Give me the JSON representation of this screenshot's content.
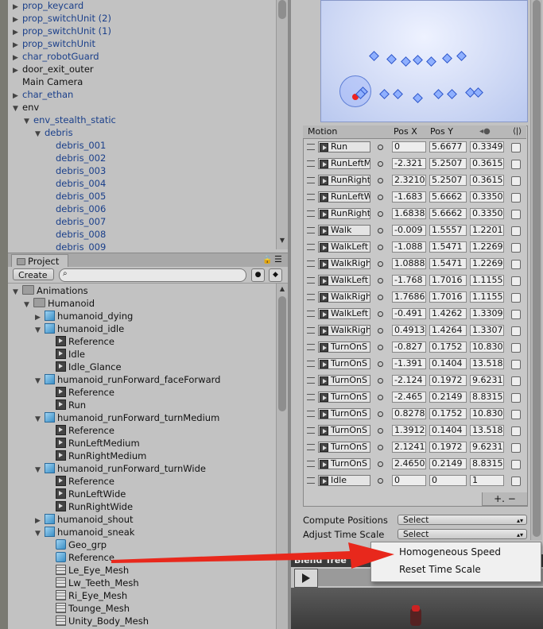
{
  "hierarchy": {
    "items": [
      {
        "label": "prop_keycard",
        "indent": 0,
        "arrow": "▶",
        "blue": true
      },
      {
        "label": "prop_switchUnit (2)",
        "indent": 0,
        "arrow": "▶",
        "blue": true
      },
      {
        "label": "prop_switchUnit (1)",
        "indent": 0,
        "arrow": "▶",
        "blue": true
      },
      {
        "label": "prop_switchUnit",
        "indent": 0,
        "arrow": "▶",
        "blue": true
      },
      {
        "label": "char_robotGuard",
        "indent": 0,
        "arrow": "▶",
        "blue": true
      },
      {
        "label": "door_exit_outer",
        "indent": 0,
        "arrow": "▶",
        "blue": false
      },
      {
        "label": "Main Camera",
        "indent": 0,
        "arrow": "",
        "blue": false
      },
      {
        "label": "char_ethan",
        "indent": 0,
        "arrow": "▶",
        "blue": true
      },
      {
        "label": "env",
        "indent": 0,
        "arrow": "▼",
        "blue": false
      },
      {
        "label": "env_stealth_static",
        "indent": 1,
        "arrow": "▼",
        "blue": true
      },
      {
        "label": "debris",
        "indent": 2,
        "arrow": "▼",
        "blue": true
      },
      {
        "label": "debris_001",
        "indent": 3,
        "arrow": "",
        "blue": true
      },
      {
        "label": "debris_002",
        "indent": 3,
        "arrow": "",
        "blue": true
      },
      {
        "label": "debris_003",
        "indent": 3,
        "arrow": "",
        "blue": true
      },
      {
        "label": "debris_004",
        "indent": 3,
        "arrow": "",
        "blue": true
      },
      {
        "label": "debris_005",
        "indent": 3,
        "arrow": "",
        "blue": true
      },
      {
        "label": "debris_006",
        "indent": 3,
        "arrow": "",
        "blue": true
      },
      {
        "label": "debris_007",
        "indent": 3,
        "arrow": "",
        "blue": true
      },
      {
        "label": "debris_008",
        "indent": 3,
        "arrow": "",
        "blue": true
      },
      {
        "label": "debris_009",
        "indent": 3,
        "arrow": "",
        "blue": true
      }
    ]
  },
  "project": {
    "tab": "Project",
    "create": "Create ▾",
    "items": [
      {
        "label": "Animations",
        "indent": 0,
        "arrow": "▼",
        "icon": "folder"
      },
      {
        "label": "Humanoid",
        "indent": 1,
        "arrow": "▼",
        "icon": "folder"
      },
      {
        "label": "humanoid_dying",
        "indent": 2,
        "arrow": "▶",
        "icon": "cube"
      },
      {
        "label": "humanoid_idle",
        "indent": 2,
        "arrow": "▼",
        "icon": "cube"
      },
      {
        "label": "Reference",
        "indent": 3,
        "arrow": "",
        "icon": "clip"
      },
      {
        "label": "Idle",
        "indent": 3,
        "arrow": "",
        "icon": "clip"
      },
      {
        "label": "Idle_Glance",
        "indent": 3,
        "arrow": "",
        "icon": "clip"
      },
      {
        "label": "humanoid_runForward_faceForward",
        "indent": 2,
        "arrow": "▼",
        "icon": "cube"
      },
      {
        "label": "Reference",
        "indent": 3,
        "arrow": "",
        "icon": "clip"
      },
      {
        "label": "Run",
        "indent": 3,
        "arrow": "",
        "icon": "clip"
      },
      {
        "label": "humanoid_runForward_turnMedium",
        "indent": 2,
        "arrow": "▼",
        "icon": "cube"
      },
      {
        "label": "Reference",
        "indent": 3,
        "arrow": "",
        "icon": "clip"
      },
      {
        "label": "RunLeftMedium",
        "indent": 3,
        "arrow": "",
        "icon": "clip"
      },
      {
        "label": "RunRightMedium",
        "indent": 3,
        "arrow": "",
        "icon": "clip"
      },
      {
        "label": "humanoid_runForward_turnWide",
        "indent": 2,
        "arrow": "▼",
        "icon": "cube"
      },
      {
        "label": "Reference",
        "indent": 3,
        "arrow": "",
        "icon": "clip"
      },
      {
        "label": "RunLeftWide",
        "indent": 3,
        "arrow": "",
        "icon": "clip"
      },
      {
        "label": "RunRightWide",
        "indent": 3,
        "arrow": "",
        "icon": "clip"
      },
      {
        "label": "humanoid_shout",
        "indent": 2,
        "arrow": "▶",
        "icon": "cube"
      },
      {
        "label": "humanoid_sneak",
        "indent": 2,
        "arrow": "▼",
        "icon": "cube"
      },
      {
        "label": "Geo_grp",
        "indent": 3,
        "arrow": "",
        "icon": "avatar"
      },
      {
        "label": "Reference",
        "indent": 3,
        "arrow": "",
        "icon": "avatar"
      },
      {
        "label": "Le_Eye_Mesh",
        "indent": 3,
        "arrow": "",
        "icon": "mesh"
      },
      {
        "label": "Lw_Teeth_Mesh",
        "indent": 3,
        "arrow": "",
        "icon": "mesh"
      },
      {
        "label": "Ri_Eye_Mesh",
        "indent": 3,
        "arrow": "",
        "icon": "mesh"
      },
      {
        "label": "Tounge_Mesh",
        "indent": 3,
        "arrow": "",
        "icon": "mesh"
      },
      {
        "label": "Unity_Body_Mesh",
        "indent": 3,
        "arrow": "",
        "icon": "mesh"
      }
    ]
  },
  "motion_table": {
    "headers": {
      "motion": "Motion",
      "posx": "Pos X",
      "posy": "Pos Y"
    },
    "rows": [
      {
        "motion": "Run",
        "x": "0",
        "y": "5.6677",
        "z": "0.3349"
      },
      {
        "motion": "RunLeftM",
        "x": "-2.321",
        "y": "5.2507",
        "z": "0.3615"
      },
      {
        "motion": "RunRight",
        "x": "2.3210",
        "y": "5.2507",
        "z": "0.3615"
      },
      {
        "motion": "RunLeftW",
        "x": "-1.683",
        "y": "5.6662",
        "z": "0.3350"
      },
      {
        "motion": "RunRight",
        "x": "1.6838",
        "y": "5.6662",
        "z": "0.3350"
      },
      {
        "motion": "Walk",
        "x": "-0.009",
        "y": "1.5557",
        "z": "1.2201"
      },
      {
        "motion": "WalkLeft",
        "x": "-1.088",
        "y": "1.5471",
        "z": "1.2269"
      },
      {
        "motion": "WalkRigh",
        "x": "1.0888",
        "y": "1.5471",
        "z": "1.2269"
      },
      {
        "motion": "WalkLeft",
        "x": "-1.768",
        "y": "1.7016",
        "z": "1.1155"
      },
      {
        "motion": "WalkRigh",
        "x": "1.7686",
        "y": "1.7016",
        "z": "1.1155"
      },
      {
        "motion": "WalkLeft",
        "x": "-0.491",
        "y": "1.4262",
        "z": "1.3309"
      },
      {
        "motion": "WalkRigh",
        "x": "0.4913",
        "y": "1.4264",
        "z": "1.3307"
      },
      {
        "motion": "TurnOnS",
        "x": "-0.827",
        "y": "0.1752",
        "z": "10.830"
      },
      {
        "motion": "TurnOnS",
        "x": "-1.391",
        "y": "0.1404",
        "z": "13.518"
      },
      {
        "motion": "TurnOnS",
        "x": "-2.124",
        "y": "0.1972",
        "z": "9.6231"
      },
      {
        "motion": "TurnOnS",
        "x": "-2.465",
        "y": "0.2149",
        "z": "8.8315"
      },
      {
        "motion": "TurnOnS",
        "x": "0.8278",
        "y": "0.1752",
        "z": "10.830"
      },
      {
        "motion": "TurnOnS",
        "x": "1.3912",
        "y": "0.1404",
        "z": "13.518"
      },
      {
        "motion": "TurnOnS",
        "x": "2.1241",
        "y": "0.1972",
        "z": "9.6231"
      },
      {
        "motion": "TurnOnS",
        "x": "2.4650",
        "y": "0.2149",
        "z": "8.8315"
      },
      {
        "motion": "Idle",
        "x": "0",
        "y": "0",
        "z": "1"
      }
    ],
    "plusminus": "+.  −"
  },
  "options": {
    "compute_label": "Compute Positions",
    "compute_value": "Select",
    "adjust_label": "Adjust Time Scale",
    "adjust_value": "Select"
  },
  "menu": {
    "items": [
      "Homogeneous Speed",
      "Reset Time Scale"
    ]
  },
  "blend_tree": {
    "title": "Blend Tree"
  },
  "colors": {
    "arrow": "#e8281c",
    "selection": "#3b73c9"
  }
}
